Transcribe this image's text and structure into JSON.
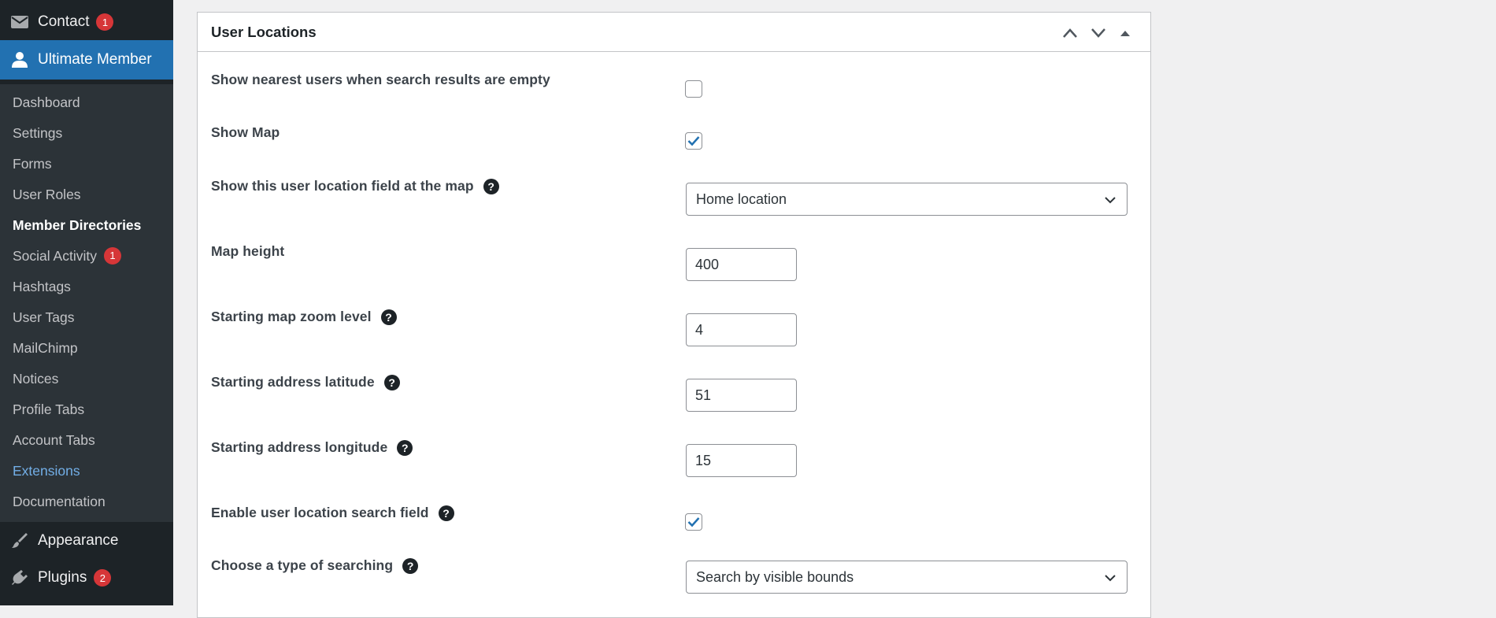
{
  "sidebar": {
    "contact": {
      "label": "Contact",
      "badge": "1",
      "icon": "envelope-icon"
    },
    "ultimate_member": {
      "label": "Ultimate Member",
      "icon": "user-icon"
    },
    "submenu": [
      {
        "label": "Dashboard"
      },
      {
        "label": "Settings"
      },
      {
        "label": "Forms"
      },
      {
        "label": "User Roles"
      },
      {
        "label": "Member Directories"
      },
      {
        "label": "Social Activity",
        "badge": "1"
      },
      {
        "label": "Hashtags"
      },
      {
        "label": "User Tags"
      },
      {
        "label": "MailChimp"
      },
      {
        "label": "Notices"
      },
      {
        "label": "Profile Tabs"
      },
      {
        "label": "Account Tabs"
      },
      {
        "label": "Extensions"
      },
      {
        "label": "Documentation"
      }
    ],
    "appearance": {
      "label": "Appearance",
      "icon": "paintbrush-icon"
    },
    "plugins": {
      "label": "Plugins",
      "badge": "2",
      "icon": "plugin-icon"
    }
  },
  "panel": {
    "title": "User Locations",
    "fields": {
      "nearest_users": {
        "label": "Show nearest users when search results are empty",
        "checked": false
      },
      "show_map": {
        "label": "Show Map",
        "checked": true
      },
      "location_field": {
        "label": "Show this user location field at the map",
        "value": "Home location"
      },
      "map_height": {
        "label": "Map height",
        "value": "400"
      },
      "zoom_level": {
        "label": "Starting map zoom level",
        "value": "4"
      },
      "latitude": {
        "label": "Starting address latitude",
        "value": "51"
      },
      "longitude": {
        "label": "Starting address longitude",
        "value": "15"
      },
      "location_search": {
        "label": "Enable user location search field",
        "checked": true
      },
      "search_type": {
        "label": "Choose a type of searching",
        "value": "Search by visible bounds"
      }
    },
    "help_glyph": "?"
  },
  "colors": {
    "sidebar_bg": "#1d2327",
    "submenu_bg": "#2c3338",
    "active_bg": "#2271b1",
    "badge": "#d63638",
    "link": "#72aee6",
    "check": "#2271b1"
  }
}
